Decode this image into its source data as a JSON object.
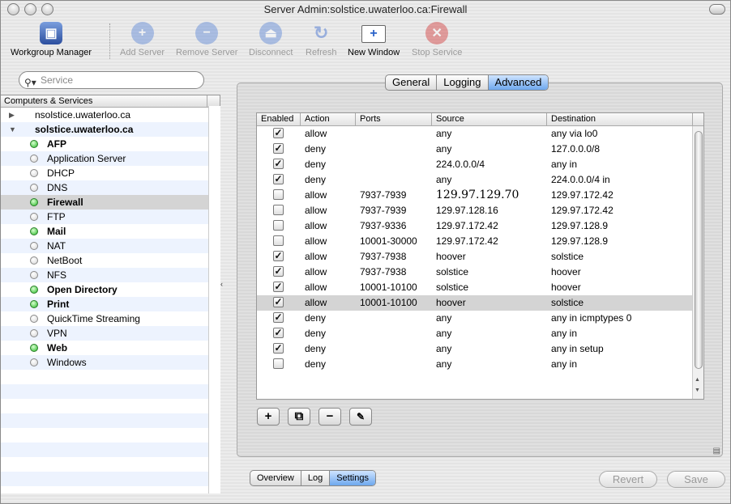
{
  "window": {
    "title": "Server Admin:solstice.uwaterloo.ca:Firewall"
  },
  "toolbar": {
    "items": [
      {
        "label": "Workgroup Manager",
        "icon": "workgroup-manager-icon",
        "enabled": true
      },
      {
        "label": "Add Server",
        "icon": "add-icon",
        "enabled": false
      },
      {
        "label": "Remove Server",
        "icon": "remove-icon",
        "enabled": false
      },
      {
        "label": "Disconnect",
        "icon": "eject-icon",
        "enabled": false
      },
      {
        "label": "Refresh",
        "icon": "refresh-icon",
        "enabled": false
      },
      {
        "label": "New Window",
        "icon": "new-window-icon",
        "enabled": true
      },
      {
        "label": "Stop Service",
        "icon": "stop-icon",
        "enabled": false
      }
    ]
  },
  "search": {
    "placeholder": "Service"
  },
  "sidebar": {
    "header": "Computers & Services",
    "servers": [
      {
        "name": "nsolstice.uwaterloo.ca",
        "expanded": false
      },
      {
        "name": "solstice.uwaterloo.ca",
        "expanded": true
      }
    ],
    "services": [
      {
        "name": "AFP",
        "running": true
      },
      {
        "name": "Application Server",
        "running": false
      },
      {
        "name": "DHCP",
        "running": false
      },
      {
        "name": "DNS",
        "running": false
      },
      {
        "name": "Firewall",
        "running": true,
        "selected": true
      },
      {
        "name": "FTP",
        "running": false
      },
      {
        "name": "Mail",
        "running": true
      },
      {
        "name": "NAT",
        "running": false
      },
      {
        "name": "NetBoot",
        "running": false
      },
      {
        "name": "NFS",
        "running": false
      },
      {
        "name": "Open Directory",
        "running": true
      },
      {
        "name": "Print",
        "running": true
      },
      {
        "name": "QuickTime Streaming",
        "running": false
      },
      {
        "name": "VPN",
        "running": false
      },
      {
        "name": "Web",
        "running": true
      },
      {
        "name": "Windows",
        "running": false
      }
    ]
  },
  "tabs": {
    "items": [
      "General",
      "Logging",
      "Advanced"
    ],
    "active": "Advanced"
  },
  "table": {
    "columns": [
      "Enabled",
      "Action",
      "Ports",
      "Source",
      "Destination"
    ],
    "rows": [
      {
        "enabled": true,
        "action": "allow",
        "ports": "",
        "source": "any",
        "destination": "any via lo0"
      },
      {
        "enabled": true,
        "action": "deny",
        "ports": "",
        "source": "any",
        "destination": "127.0.0.0/8"
      },
      {
        "enabled": true,
        "action": "deny",
        "ports": "",
        "source": "224.0.0.0/4",
        "destination": "any in"
      },
      {
        "enabled": true,
        "action": "deny",
        "ports": "",
        "source": "any",
        "destination": "224.0.0.0/4 in"
      },
      {
        "enabled": false,
        "action": "allow",
        "ports": "7937-7939",
        "source": "129.97.129.70",
        "destination": "129.97.172.42"
      },
      {
        "enabled": false,
        "action": "allow",
        "ports": "7937-7939",
        "source": "129.97.128.16",
        "destination": "129.97.172.42"
      },
      {
        "enabled": false,
        "action": "allow",
        "ports": "7937-9336",
        "source": "129.97.172.42",
        "destination": "129.97.128.9"
      },
      {
        "enabled": false,
        "action": "allow",
        "ports": "10001-30000",
        "source": "129.97.172.42",
        "destination": "129.97.128.9"
      },
      {
        "enabled": true,
        "action": "allow",
        "ports": "7937-7938",
        "source": "hoover",
        "destination": "solstice"
      },
      {
        "enabled": true,
        "action": "allow",
        "ports": "7937-7938",
        "source": "solstice",
        "destination": "hoover"
      },
      {
        "enabled": true,
        "action": "allow",
        "ports": "10001-10100",
        "source": "solstice",
        "destination": "hoover"
      },
      {
        "enabled": true,
        "action": "allow",
        "ports": "10001-10100",
        "source": "hoover",
        "destination": "solstice",
        "selected": true
      },
      {
        "enabled": true,
        "action": "deny",
        "ports": "",
        "source": "any",
        "destination": "any in icmptypes 0"
      },
      {
        "enabled": true,
        "action": "deny",
        "ports": "",
        "source": "any",
        "destination": "any in"
      },
      {
        "enabled": true,
        "action": "deny",
        "ports": "",
        "source": "any",
        "destination": "any in setup"
      },
      {
        "enabled": false,
        "action": "deny",
        "ports": "",
        "source": "any",
        "destination": "any in"
      }
    ]
  },
  "rule_buttons": [
    {
      "symbol": "+",
      "icon": "add-rule-icon"
    },
    {
      "symbol": "⧉",
      "icon": "duplicate-rule-icon"
    },
    {
      "symbol": "−",
      "icon": "remove-rule-icon"
    },
    {
      "symbol": "✎",
      "icon": "edit-rule-icon"
    }
  ],
  "bottom_tabs": {
    "items": [
      "Overview",
      "Log",
      "Settings"
    ],
    "active": "Settings"
  },
  "actions": {
    "revert": "Revert",
    "save": "Save"
  },
  "colors": {
    "accent": "#6ea8ee",
    "running": "#28b828",
    "selection": "#d4d4d4"
  }
}
